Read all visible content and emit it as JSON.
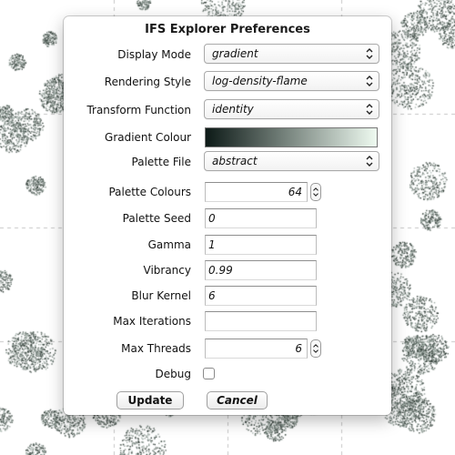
{
  "dialog": {
    "title": "IFS Explorer Preferences",
    "display_mode": {
      "label": "Display Mode",
      "value": "gradient"
    },
    "rendering_style": {
      "label": "Rendering Style",
      "value": "log-density-flame"
    },
    "transform_function": {
      "label": "Transform Function",
      "value": "identity"
    },
    "gradient_colour": {
      "label": "Gradient Colour",
      "start_color": "#0d1a17",
      "end_color": "#eefaf0"
    },
    "palette_file": {
      "label": "Palette File",
      "value": "abstract"
    },
    "palette_colours": {
      "label": "Palette Colours",
      "value": "64"
    },
    "palette_seed": {
      "label": "Palette Seed",
      "value": "0"
    },
    "gamma": {
      "label": "Gamma",
      "value": "1"
    },
    "vibrancy": {
      "label": "Vibrancy",
      "value": "0.99"
    },
    "blur_kernel": {
      "label": "Blur Kernel",
      "value": "6"
    },
    "max_iterations": {
      "label": "Max Iterations",
      "value": ""
    },
    "max_threads": {
      "label": "Max Threads",
      "value": "6"
    },
    "debug": {
      "label": "Debug",
      "checked": false
    },
    "update_label": "Update",
    "cancel_label": "Cancel"
  },
  "colors": {
    "fractal": "#3c5148",
    "background": "#ffffff"
  }
}
